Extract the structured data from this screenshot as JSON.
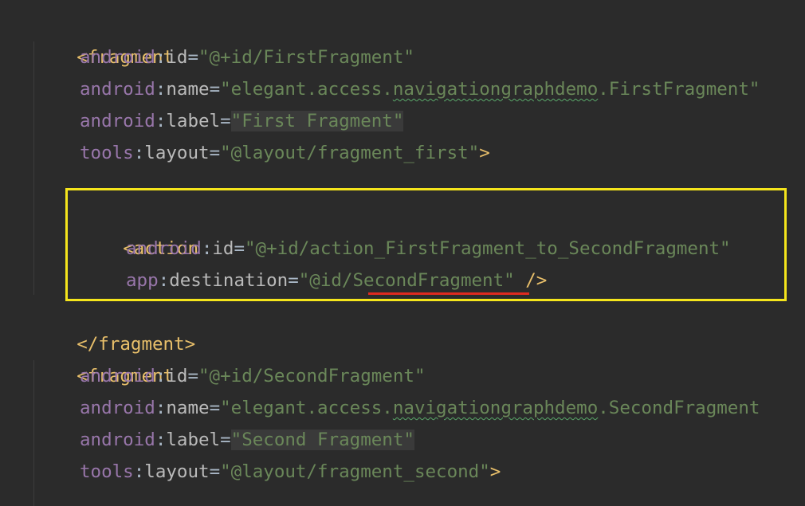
{
  "code": {
    "l1": {
      "open": "<fragment"
    },
    "l2": {
      "ns": "android",
      "colon": ":",
      "attr": "id",
      "eq": "=",
      "value": "\"@+id/FirstFragment\""
    },
    "l3": {
      "ns": "android",
      "colon": ":",
      "attr": "name",
      "eq": "=",
      "v1": "\"elegant.access.",
      "v2": "navigationgraphdemo",
      "v3": ".FirstFragment\""
    },
    "l4": {
      "ns": "android",
      "colon": ":",
      "attr": "label",
      "eq": "=",
      "value": "\"First Fragment\""
    },
    "l5": {
      "ns": "tools",
      "colon": ":",
      "attr": "layout",
      "eq": "=",
      "value": "\"@layout/fragment_first\"",
      "close": ">"
    },
    "l7": {
      "open": "<action"
    },
    "l8": {
      "ns": "android",
      "colon": ":",
      "attr": "id",
      "eq": "=",
      "value": "\"@+id/action_FirstFragment_to_SecondFragment\""
    },
    "l9": {
      "ns": "app",
      "colon": ":",
      "attr": "destination",
      "eq": "=",
      "v1": "\"@id/",
      "v2": "SecondFragment",
      "v3": "\"",
      "close": " />"
    },
    "l10": {
      "close": "</fragment>"
    },
    "l11": {
      "open": "<fragment"
    },
    "l12": {
      "ns": "android",
      "colon": ":",
      "attr": "id",
      "eq": "=",
      "value": "\"@+id/SecondFragment\""
    },
    "l13": {
      "ns": "android",
      "colon": ":",
      "attr": "name",
      "eq": "=",
      "v1": "\"elegant.access.",
      "v2": "navigationgraphdemo",
      "v3": ".SecondFragment"
    },
    "l14": {
      "ns": "android",
      "colon": ":",
      "attr": "label",
      "eq": "=",
      "value": "\"Second Fragment\""
    },
    "l15": {
      "ns": "tools",
      "colon": ":",
      "attr": "layout",
      "eq": "=",
      "value": "\"@layout/fragment_second\"",
      "close": ">"
    }
  },
  "colors": {
    "background": "#2b2b2b",
    "tag": "#e8bf6a",
    "namespace": "#9876aa",
    "string": "#6a8759",
    "highlight_box": "#f5e51c",
    "error_underline": "#e02a1f"
  }
}
